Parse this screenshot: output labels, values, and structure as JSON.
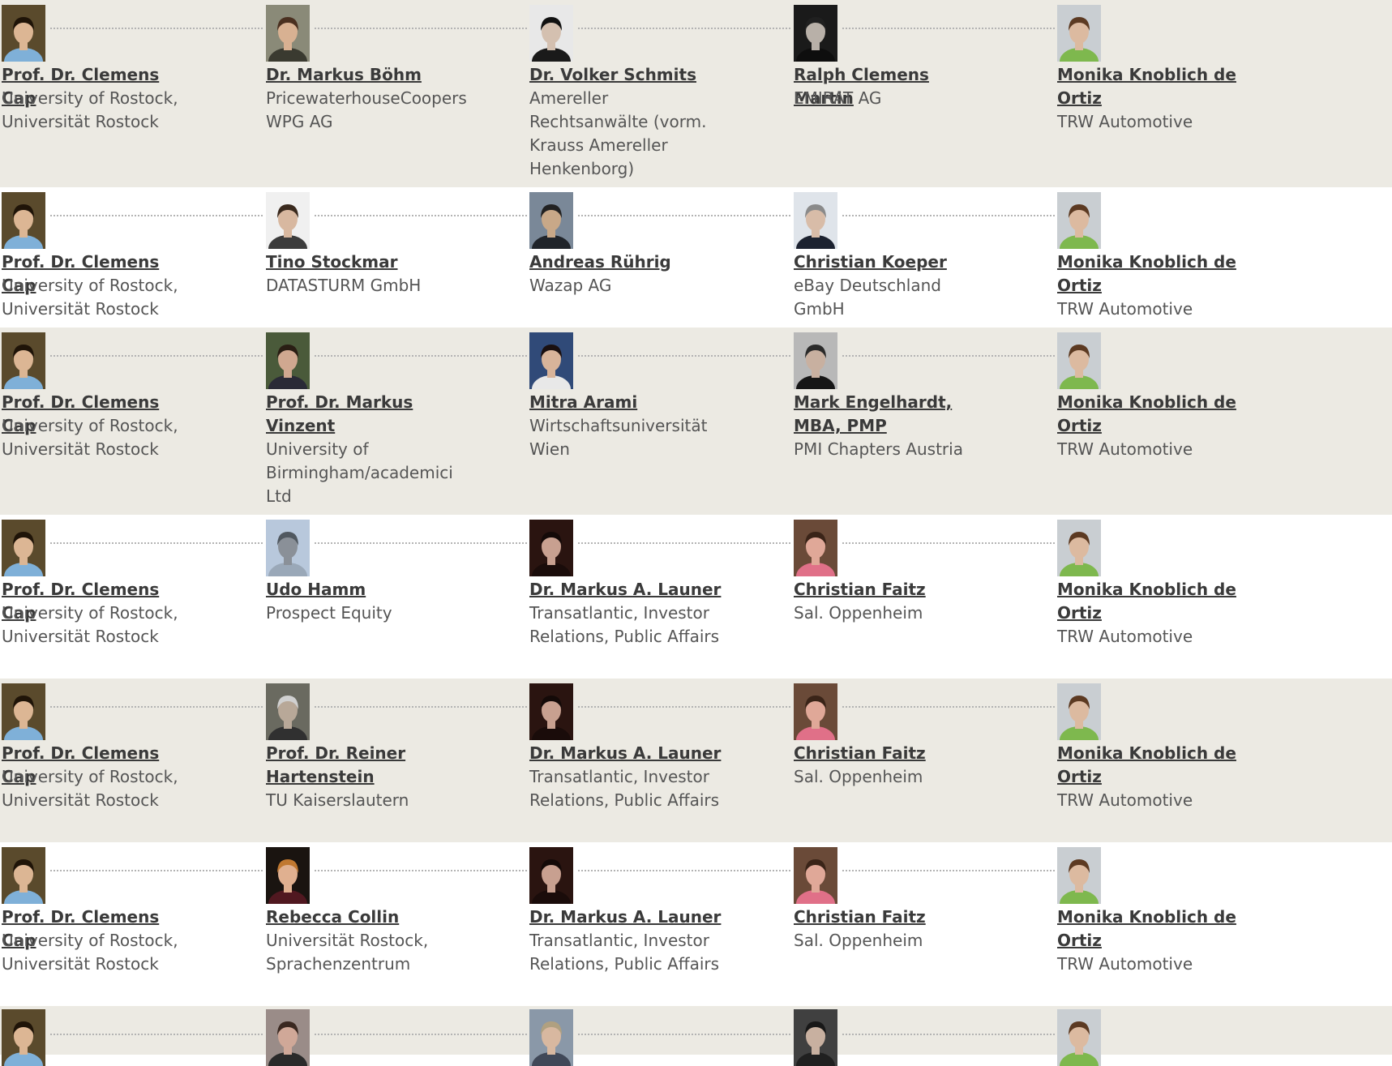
{
  "paths": [
    {
      "shade": true,
      "people": [
        {
          "name": "Prof. Dr. Clemens Cap",
          "org": "University of Rostock, Universität Rostock",
          "photo": {
            "bg": "#5a4a2c",
            "skin": "#dcb694",
            "hair": "#1f1408",
            "shirt": "#7fb0d8"
          }
        },
        {
          "name": "Dr. Markus Böhm",
          "org": "PricewaterhouseCoopers WPG AG",
          "photo": {
            "bg": "#8a8a78",
            "skin": "#d8b192",
            "hair": "#4a3020",
            "shirt": "#3a3a30"
          }
        },
        {
          "name": "Dr. Volker Schmits",
          "org": "Amereller Rechtsanwälte (vorm. Krauss Amereller Henkenborg)",
          "photo": {
            "bg": "#e8e8e8",
            "skin": "#d4c0b0",
            "hair": "#111111",
            "shirt": "#1a1a1a"
          }
        },
        {
          "name": "Ralph Clemens Martin",
          "org": "EMIRAT AG",
          "photo": {
            "bg": "#1a1a1a",
            "skin": "#b8b0a8",
            "hair": "#202020",
            "shirt": "#0e0e0e"
          }
        },
        {
          "name": "Monika Knoblich de Ortiz",
          "org": "TRW Automotive",
          "photo": {
            "bg": "#c9ced2",
            "skin": "#dcbaa0",
            "hair": "#5c3a22",
            "shirt": "#7eb84e"
          }
        }
      ]
    },
    {
      "shade": false,
      "people": [
        {
          "name": "Prof. Dr. Clemens Cap",
          "org": "University of Rostock, Universität Rostock",
          "photo": {
            "bg": "#5a4a2c",
            "skin": "#dcb694",
            "hair": "#1f1408",
            "shirt": "#7fb0d8"
          }
        },
        {
          "name": "Tino Stockmar",
          "org": "DATASTURM GmbH",
          "photo": {
            "bg": "#f0f0f0",
            "skin": "#d8b8a0",
            "hair": "#3a2a1e",
            "shirt": "#3c3c3c"
          }
        },
        {
          "name": "Andreas Rührig",
          "org": "Wazap AG",
          "photo": {
            "bg": "#7a8898",
            "skin": "#c8a888",
            "hair": "#222222",
            "shirt": "#20242a"
          }
        },
        {
          "name": "Christian Koeper",
          "org": "eBay Deutschland GmbH",
          "photo": {
            "bg": "#dfe4ea",
            "skin": "#d8bca8",
            "hair": "#8a8a8a",
            "shirt": "#1c2230"
          }
        },
        {
          "name": "Monika Knoblich de Ortiz",
          "org": "TRW Automotive",
          "photo": {
            "bg": "#c9ced2",
            "skin": "#dcbaa0",
            "hair": "#5c3a22",
            "shirt": "#7eb84e"
          }
        }
      ]
    },
    {
      "shade": true,
      "people": [
        {
          "name": "Prof. Dr. Clemens Cap",
          "org": "University of Rostock, Universität Rostock",
          "photo": {
            "bg": "#5a4a2c",
            "skin": "#dcb694",
            "hair": "#1f1408",
            "shirt": "#7fb0d8"
          }
        },
        {
          "name": "Prof. Dr. Markus Vinzent",
          "org": "University of Birmingham/academici Ltd",
          "photo": {
            "bg": "#4a5a3a",
            "skin": "#d0a890",
            "hair": "#2a1e14",
            "shirt": "#2a2a36"
          }
        },
        {
          "name": "Mitra Arami",
          "org": "Wirtschaftsuniversität Wien",
          "photo": {
            "bg": "#304a78",
            "skin": "#d8b49a",
            "hair": "#1a1010",
            "shirt": "#e8e8e8"
          }
        },
        {
          "name": "Mark Engelhardt, MBA, PMP",
          "org": "PMI Chapters Austria",
          "photo": {
            "bg": "#b8b8b8",
            "skin": "#c8b0a0",
            "hair": "#2a2a2a",
            "shirt": "#161616"
          }
        },
        {
          "name": "Monika Knoblich de Ortiz",
          "org": "TRW Automotive",
          "photo": {
            "bg": "#c9ced2",
            "skin": "#dcbaa0",
            "hair": "#5c3a22",
            "shirt": "#7eb84e"
          }
        }
      ]
    },
    {
      "shade": false,
      "people": [
        {
          "name": "Prof. Dr. Clemens Cap",
          "org": "University of Rostock, Universität Rostock",
          "photo": {
            "bg": "#5a4a2c",
            "skin": "#dcb694",
            "hair": "#1f1408",
            "shirt": "#7fb0d8"
          }
        },
        {
          "name": "Udo Hamm",
          "org": "Prospect Equity",
          "photo": {
            "bg": "#b8c8dc",
            "skin": "#8a9098",
            "hair": "#505860",
            "shirt": "#9aa8b8"
          }
        },
        {
          "name": "Dr. Markus A. Launer",
          "org": "Transatlantic, Investor Relations, Public Affairs",
          "photo": {
            "bg": "#2a1410",
            "skin": "#c8a090",
            "hair": "#140a08",
            "shirt": "#1a0c0a"
          }
        },
        {
          "name": "Christian Faitz",
          "org": "Sal. Oppenheim",
          "photo": {
            "bg": "#6a4a38",
            "skin": "#e0a898",
            "hair": "#3a2418",
            "shirt": "#e07088"
          }
        },
        {
          "name": "Monika Knoblich de Ortiz",
          "org": "TRW Automotive",
          "photo": {
            "bg": "#c9ced2",
            "skin": "#dcbaa0",
            "hair": "#5c3a22",
            "shirt": "#7eb84e"
          }
        }
      ]
    },
    {
      "shade": true,
      "people": [
        {
          "name": "Prof. Dr. Clemens Cap",
          "org": "University of Rostock, Universität Rostock",
          "photo": {
            "bg": "#5a4a2c",
            "skin": "#dcb694",
            "hair": "#1f1408",
            "shirt": "#7fb0d8"
          }
        },
        {
          "name": "Prof. Dr. Reiner Hartenstein",
          "org": "TU Kaiserslautern",
          "photo": {
            "bg": "#6a6a60",
            "skin": "#b8a898",
            "hair": "#d0d0d0",
            "shirt": "#303030"
          }
        },
        {
          "name": "Dr. Markus A. Launer",
          "org": "Transatlantic, Investor Relations, Public Affairs",
          "photo": {
            "bg": "#2a1410",
            "skin": "#c8a090",
            "hair": "#140a08",
            "shirt": "#1a0c0a"
          }
        },
        {
          "name": "Christian Faitz",
          "org": "Sal. Oppenheim",
          "photo": {
            "bg": "#6a4a38",
            "skin": "#e0a898",
            "hair": "#3a2418",
            "shirt": "#e07088"
          }
        },
        {
          "name": "Monika Knoblich de Ortiz",
          "org": "TRW Automotive",
          "photo": {
            "bg": "#c9ced2",
            "skin": "#dcbaa0",
            "hair": "#5c3a22",
            "shirt": "#7eb84e"
          }
        }
      ]
    },
    {
      "shade": false,
      "people": [
        {
          "name": "Prof. Dr. Clemens Cap",
          "org": "University of Rostock, Universität Rostock",
          "photo": {
            "bg": "#5a4a2c",
            "skin": "#dcb694",
            "hair": "#1f1408",
            "shirt": "#7fb0d8"
          }
        },
        {
          "name": "Rebecca Collin",
          "org": "Universität Rostock, Sprachenzentrum",
          "photo": {
            "bg": "#1a1410",
            "skin": "#e0b090",
            "hair": "#c07830",
            "shirt": "#501820"
          }
        },
        {
          "name": "Dr. Markus A. Launer",
          "org": "Transatlantic, Investor Relations, Public Affairs",
          "photo": {
            "bg": "#2a1410",
            "skin": "#c8a090",
            "hair": "#140a08",
            "shirt": "#1a0c0a"
          }
        },
        {
          "name": "Christian Faitz",
          "org": "Sal. Oppenheim",
          "photo": {
            "bg": "#6a4a38",
            "skin": "#e0a898",
            "hair": "#3a2418",
            "shirt": "#e07088"
          }
        },
        {
          "name": "Monika Knoblich de Ortiz",
          "org": "TRW Automotive",
          "photo": {
            "bg": "#c9ced2",
            "skin": "#dcbaa0",
            "hair": "#5c3a22",
            "shirt": "#7eb84e"
          }
        }
      ]
    },
    {
      "shade": true,
      "people": [
        {
          "photo": {
            "bg": "#5a4a2c",
            "skin": "#dcb694",
            "hair": "#1f1408",
            "shirt": "#7fb0d8"
          }
        },
        {
          "photo": {
            "bg": "#9a8c88",
            "skin": "#d0a898",
            "hair": "#3a2820",
            "shirt": "#2a2a2a"
          }
        },
        {
          "photo": {
            "bg": "#8a98a8",
            "skin": "#d8b8a0",
            "hair": "#b0a080",
            "shirt": "#404858"
          }
        },
        {
          "photo": {
            "bg": "#404040",
            "skin": "#c8b0a0",
            "hair": "#181818",
            "shirt": "#202020"
          }
        },
        {
          "photo": {
            "bg": "#c9ced2",
            "skin": "#dcbaa0",
            "hair": "#5c3a22",
            "shirt": "#7eb84e"
          }
        }
      ]
    }
  ]
}
